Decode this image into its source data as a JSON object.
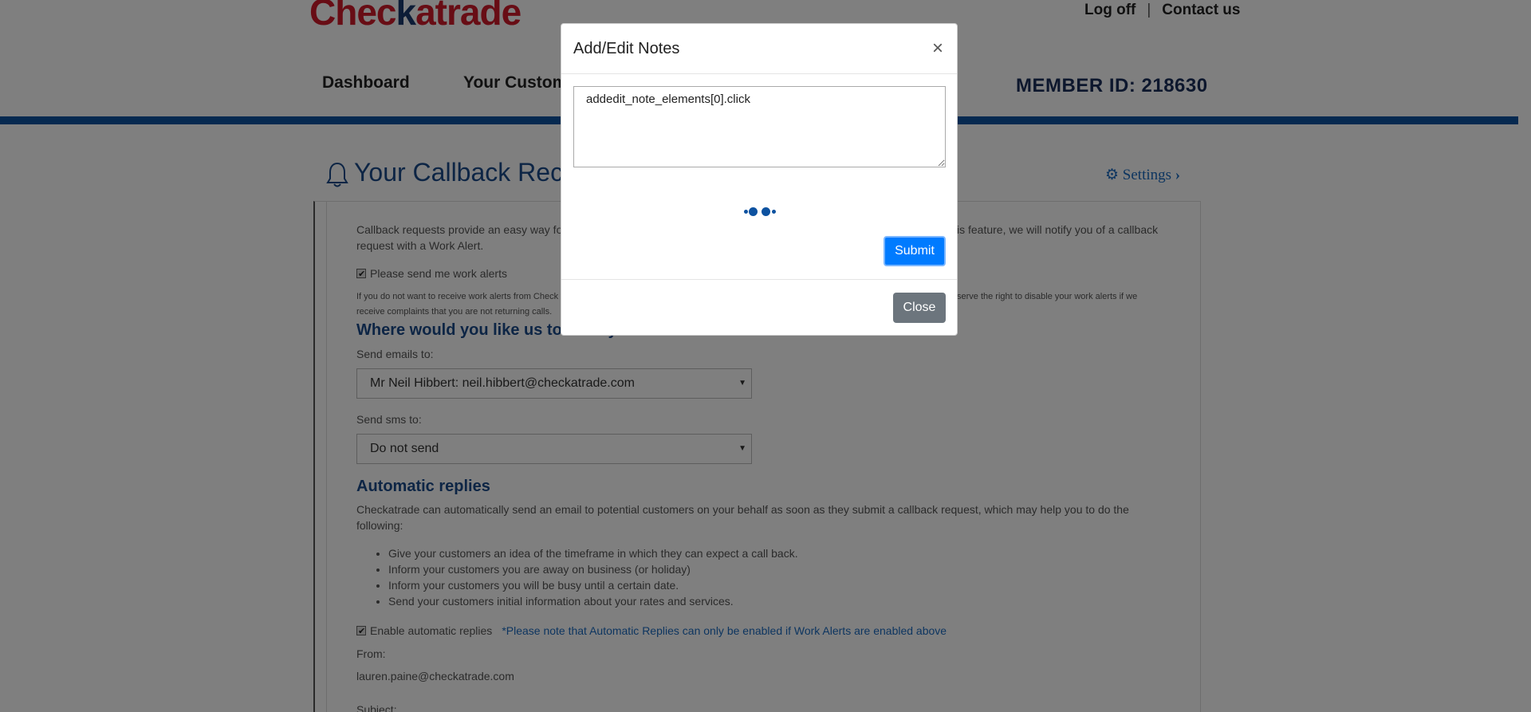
{
  "header": {
    "logo_red_1": "Chec",
    "logo_blue": "k",
    "logo_red_2": "atrade",
    "log_off": "Log off",
    "separator": "|",
    "contact_us": "Contact us",
    "nav_dashboard": "Dashboard",
    "nav_customers": "Your Custome",
    "member_id": "MEMBER ID: 218630"
  },
  "page": {
    "title": "Your Callback Rec",
    "settings": "Settings",
    "intro_1a": "Callback requests provide an easy way fo",
    "intro_1b": "is feature, we will notify you of a callback",
    "intro_2": "request with a Work Alert.",
    "work_alerts_label": "Please send me work alerts",
    "disclaimer_1a": "If you do not want to receive work alerts from Check",
    "disclaimer_1b": "serve the right to disable your work alerts if we",
    "disclaimer_2": "receive complaints that you are not returning calls.",
    "where_heading": "Where would you like us to send your work alerts?",
    "send_emails_label": "Send emails to:",
    "send_emails_value": "Mr Neil Hibbert: neil.hibbert@checkatrade.com",
    "send_sms_label": "Send sms to:",
    "send_sms_value": "Do not send",
    "auto_heading": "Automatic replies",
    "auto_desc_1": "Checkatrade can automatically send an email to potential customers on your behalf as soon as they submit a callback request, which may help you to do the",
    "auto_desc_2": "following:",
    "bullets": [
      "Give your customers an idea of the timeframe in which they can expect a call back.",
      "Inform your customers you are away on business (or holiday)",
      "Inform your customers you will be busy until a certain date.",
      "Send your customers initial information about your rates and services."
    ],
    "enable_auto_label": "Enable automatic replies",
    "enable_auto_note": "*Please note that Automatic Replies can only be enabled if Work Alerts are enabled above",
    "from_label": "From:",
    "from_value": "lauren.paine@checkatrade.com",
    "subject_label": "Subject:"
  },
  "modal": {
    "title": "Add/Edit Notes",
    "close_x": "×",
    "notes_value": "addedit_note_elements[0].click",
    "submit": "Submit",
    "close": "Close"
  },
  "colors": {
    "brand_blue": "#0d52a0",
    "brand_red": "#d11a2a",
    "primary_button": "#007bff",
    "secondary_button": "#6c757d"
  }
}
